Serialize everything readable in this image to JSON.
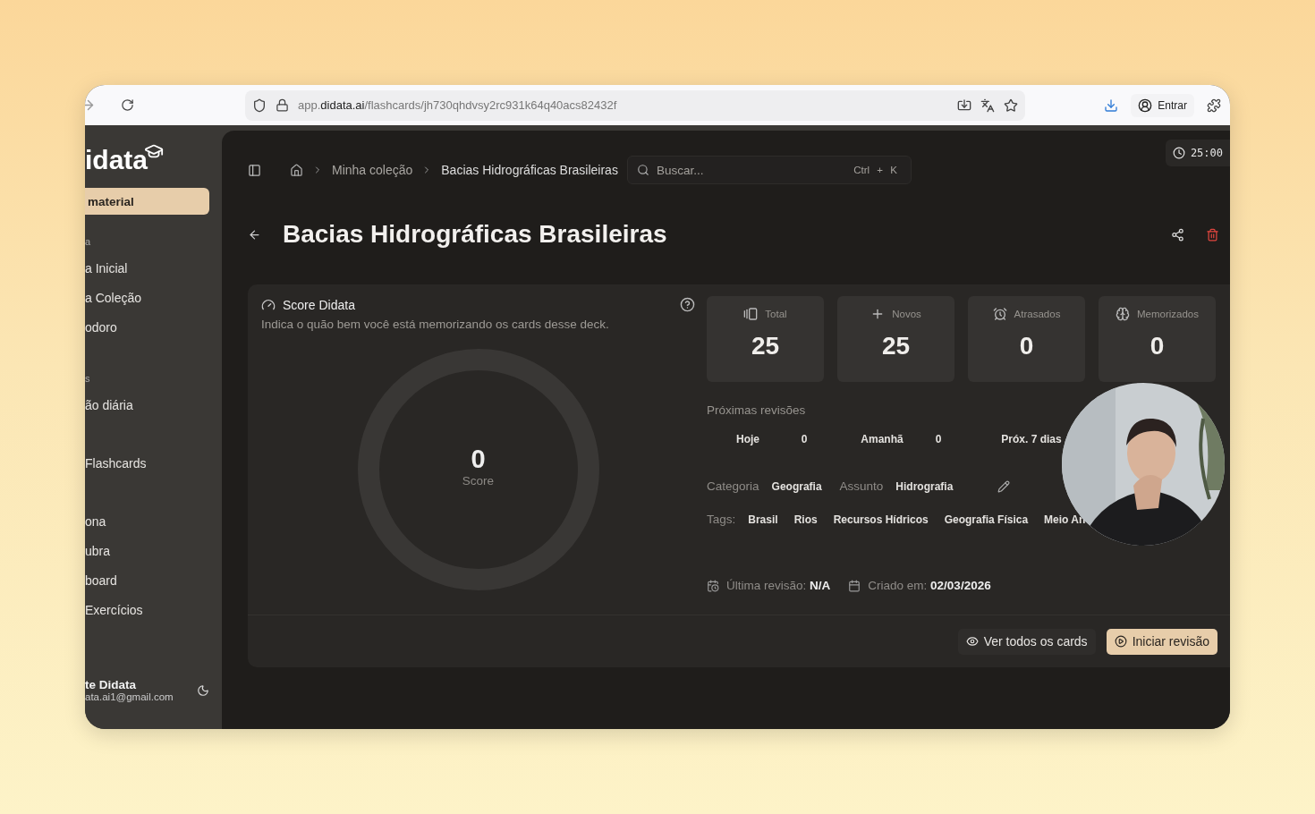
{
  "browser": {
    "url": "app.**didata.ai**/flashcards/jh730qhdvsy2rc931k64q40acs82432f",
    "profile_button": "Entrar"
  },
  "sidebar": {
    "logo": "idata",
    "new_button": "material",
    "sections": [
      {
        "header": "a",
        "items": [
          "a Inicial",
          "a Coleção",
          "odoro"
        ]
      },
      {
        "header": "s",
        "items": [
          "ão diária"
        ]
      },
      {
        "items": [
          "Flashcards"
        ]
      },
      {
        "items": [
          "ona",
          "ubra",
          "board",
          "Exercícios"
        ]
      }
    ],
    "user": {
      "name": "te Didata",
      "email": "ata.ai1@gmail.com"
    }
  },
  "header": {
    "breadcrumb": [
      "Minha coleção",
      "Bacias Hidrográficas Brasileiras"
    ],
    "search": {
      "placeholder": "Buscar...",
      "shortcut": [
        "Ctrl",
        "+",
        "K"
      ]
    },
    "timer": "25:00"
  },
  "deck": {
    "title": "Bacias Hidrográficas Brasileiras",
    "score": {
      "title": "Score Didata",
      "description": "Indica o quão bem você está memorizando os cards desse deck.",
      "value": "0",
      "label": "Score"
    },
    "stats": [
      {
        "kind": "total",
        "label": "Total",
        "value": "25"
      },
      {
        "kind": "new",
        "label": "Novos",
        "value": "25"
      },
      {
        "kind": "overdue",
        "label": "Atrasados",
        "value": "0"
      },
      {
        "kind": "memorized",
        "label": "Memorizados",
        "value": "0"
      }
    ],
    "upcoming": {
      "title": "Próximas revisões",
      "items": [
        {
          "label": "Hoje",
          "value": "0"
        },
        {
          "label": "Amanhã",
          "value": "0"
        },
        {
          "label": "Próx. 7 dias"
        }
      ]
    },
    "category_label": "Categoria",
    "category": "Geografia",
    "subject_label": "Assunto",
    "subject": "Hidrografia",
    "tags_label": "Tags:",
    "tags": [
      "Brasil",
      "Rios",
      "Recursos Hídricos",
      "Geografia Física",
      "Meio An"
    ],
    "last_review_label": "Última revisão:",
    "last_review": "N/A",
    "created_label": "Criado em:",
    "created": "02/03/2026",
    "buttons": {
      "view_all": "Ver todos os cards",
      "start": "Iniciar revisão"
    }
  }
}
